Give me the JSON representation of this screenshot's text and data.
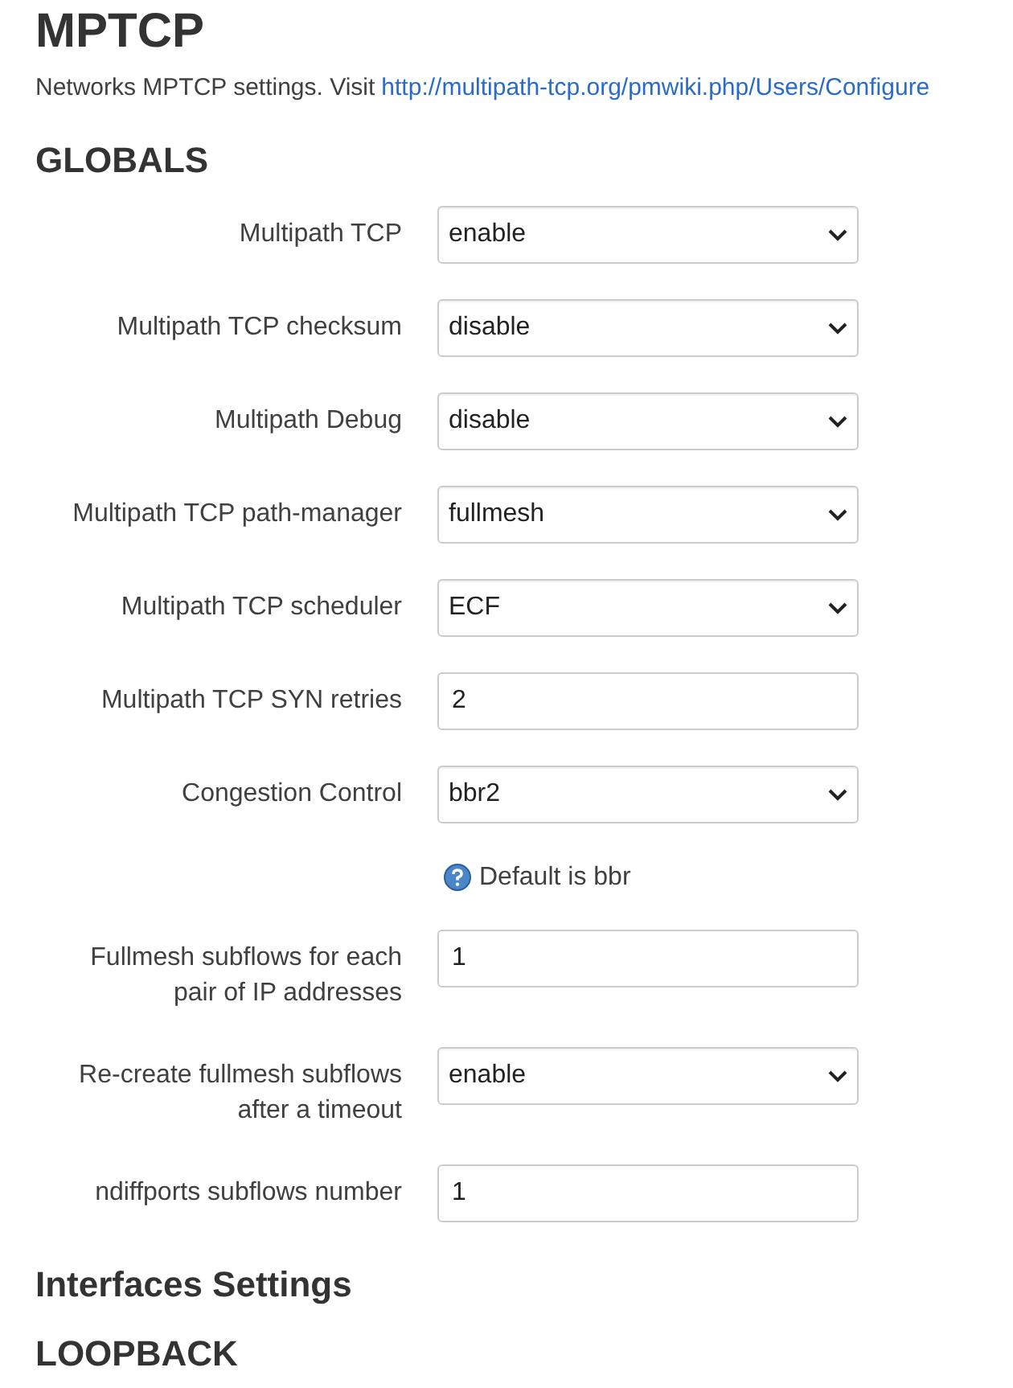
{
  "title": "MPTCP",
  "description": {
    "text": "Networks MPTCP settings. Visit",
    "link": "http://multipath-tcp.org/pmwiki.php/Users/Configure"
  },
  "section": "GLOBALS",
  "fields": [
    {
      "kind": "select",
      "label": "Multipath TCP",
      "value": "enable"
    },
    {
      "kind": "select",
      "label": "Multipath TCP checksum",
      "value": "disable"
    },
    {
      "kind": "select",
      "label": "Multipath Debug",
      "value": "disable"
    },
    {
      "kind": "select",
      "label": "Multipath TCP path-manager",
      "value": "fullmesh"
    },
    {
      "kind": "select",
      "label": "Multipath TCP scheduler",
      "value": "ECF"
    },
    {
      "kind": "input",
      "label": "Multipath TCP SYN retries",
      "value": "2"
    },
    {
      "kind": "select",
      "label": "Congestion Control",
      "value": "bbr2"
    },
    {
      "kind": "help",
      "text": "Default is bbr"
    },
    {
      "kind": "input",
      "label": "Fullmesh subflows for each pair of IP addresses",
      "value": "1"
    },
    {
      "kind": "select",
      "label": "Re-create fullmesh subflows after a timeout",
      "value": "enable"
    },
    {
      "kind": "input",
      "label": "ndiffports subflows number",
      "value": "1"
    }
  ],
  "subsection": "Interfaces Settings",
  "next_section": "LOOPBACK"
}
